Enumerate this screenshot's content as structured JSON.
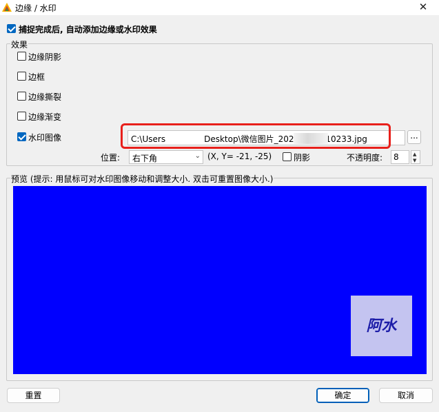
{
  "window": {
    "title": "边缘 / 水印",
    "close_glyph": "✕"
  },
  "auto_add": {
    "label": "捕捉完成后, 自动添加边缘或水印效果",
    "checked": true
  },
  "effects": {
    "legend": "效果",
    "items": [
      {
        "label": "边缘阴影",
        "checked": false
      },
      {
        "label": "边框",
        "checked": false
      },
      {
        "label": "边缘撕裂",
        "checked": false
      },
      {
        "label": "边缘渐变",
        "checked": false
      },
      {
        "label": "水印图像",
        "checked": true
      }
    ],
    "watermark_path": "C:\\Users        Desktop\\微信图片_20230530210233.jpg",
    "path_before_blur": "C:\\Users",
    "path_after_blur": "Desktop\\微信图片_20230530210233.jpg",
    "browse_label": "...",
    "position_label": "位置:",
    "position_value": "右下角",
    "coords_text": "(X, Y= -21, -25)",
    "shadow_label": "阴影",
    "shadow_checked": false,
    "opacity_label": "不透明度:",
    "opacity_value": "8"
  },
  "preview": {
    "legend": "预览 (提示: 用鼠标可对水印图像移动和调整大小. 双击可重置图像大小.)",
    "background_color": "#0000ff",
    "watermark_text": "阿水"
  },
  "buttons": {
    "reset": "重置",
    "ok": "确定",
    "cancel": "取消"
  },
  "icons": {
    "app": "app-logo-icon",
    "close": "close-icon",
    "dropdown": "chevron-down-icon"
  }
}
